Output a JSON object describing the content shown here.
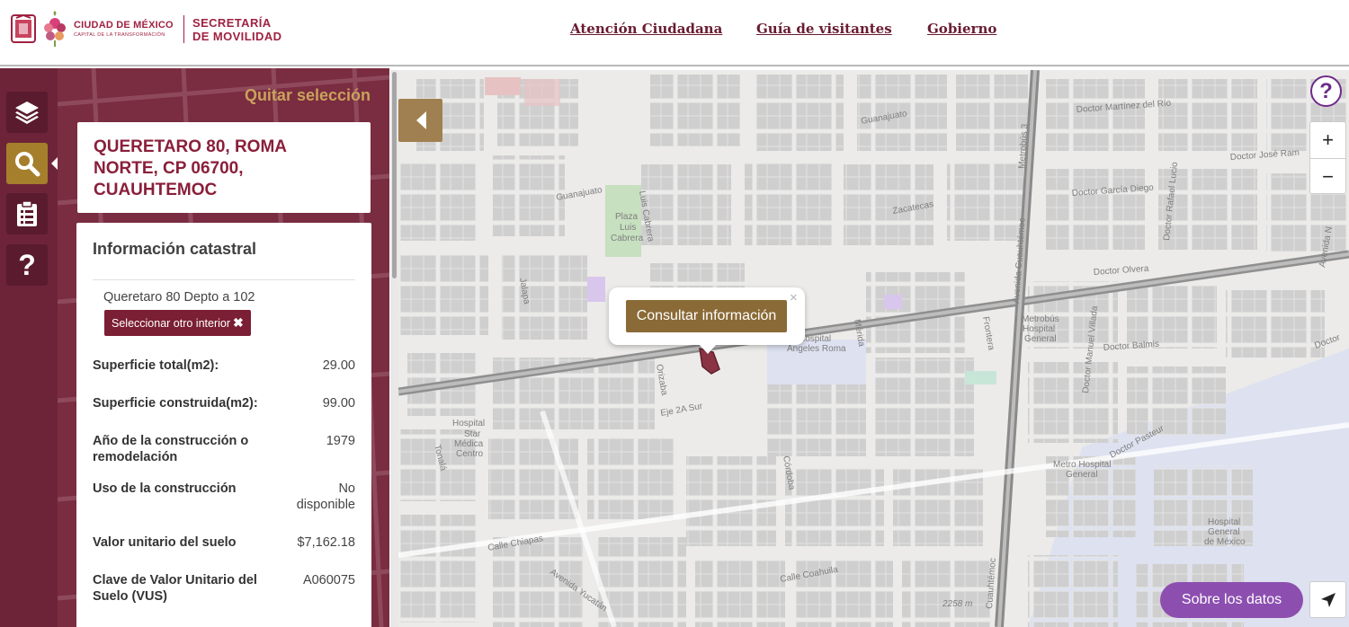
{
  "header": {
    "brand_city": "CIUDAD DE MÉXICO",
    "brand_city_sub": "CAPITAL DE LA TRANSFORMACIÓN",
    "brand_secretaria_1": "SECRETARÍA",
    "brand_secretaria_2": "DE MOVILIDAD",
    "nav": [
      "Atención Ciudadana",
      "Guía de visitantes",
      "Gobierno"
    ]
  },
  "sidebar": {
    "icons": [
      "layers-icon",
      "search-icon",
      "clipboard-icon",
      "help-icon"
    ],
    "active": "search-icon"
  },
  "panel": {
    "clear_label": "Quitar selección",
    "address": "QUERETARO 80, ROMA NORTE, CP 06700, CUAUHTEMOC",
    "section_title": "Información catastral",
    "interior": "Queretaro 80 Depto a 102",
    "select_other": "Seleccionar otro interior",
    "rows": [
      {
        "label": "Superficie total(m2):",
        "value": "29.00"
      },
      {
        "label": "Superficie construida(m2):",
        "value": "99.00"
      },
      {
        "label": "Año de la construcción o remodelación",
        "value": "1979"
      },
      {
        "label": "Uso de la construcción",
        "value": "No disponible"
      },
      {
        "label": "Valor unitario del suelo",
        "value": "$7,162.18"
      },
      {
        "label": "Clave de Valor Unitario del Suelo (VUS)",
        "value": "A060075"
      }
    ]
  },
  "map": {
    "popup_button": "Consultar información",
    "popup_close": "×",
    "help": "?",
    "zoom_in": "+",
    "zoom_out": "−",
    "about_data": "Sobre los datos",
    "labels": {
      "guanajuato": "Guanajuato",
      "guanajuato2": "Guanajuato",
      "zacatecas": "Zacatecas",
      "plaza": "Plaza",
      "luis": "Luis",
      "cabrera_plaza": "Cabrera",
      "luis_cabrera": "Luis Cabrera",
      "jalapa": "Jalapa",
      "orizaba": "Orizaba",
      "merida": "Mérida",
      "frontera": "Frontera",
      "eje2a": "Eje 2A Sur",
      "hospital_angeles_1": "Hospital",
      "hospital_angeles_2": "Ángeles Roma",
      "hospital_star_1": "Hospital",
      "hospital_star_2": "Star",
      "hospital_star_3": "Médica",
      "hospital_star_4": "Centro",
      "tonala": "Tonalá",
      "cordoba": "Córdoba",
      "chiapas": "Calle Chiapas",
      "coahuila": "Calle Coahuila",
      "yucatan": "Avenida Yucatán",
      "cuauhtemoc": "Avenida Cuauhtémoc",
      "cuauhtemoc2": "Cuauhtémoc",
      "metrobus_3": "Metrobús 3",
      "metrobus_hospital_1": "Metrobús",
      "metrobus_hospital_2": "Hospital",
      "metrobus_hospital_3": "General",
      "martinez": "Doctor Martínez del Río",
      "garcia_diego": "Doctor García Diego",
      "lucio": "Doctor Rafael Lucio",
      "jose_ram": "Doctor José Ram",
      "olvera": "Doctor Olvera",
      "balmis": "Doctor Balmis",
      "villada": "Doctor Manuel Villada",
      "pasteur": "Doctor Pasteur",
      "metro_hospital_1": "Metro Hospital",
      "metro_hospital_2": "General",
      "hospital_general_1": "Hospital",
      "hospital_general_2": "General",
      "hospital_general_3": "de México",
      "avenida_n": "Avenida N",
      "doctor_left": "Doctor",
      "elev": "2258 m"
    }
  }
}
